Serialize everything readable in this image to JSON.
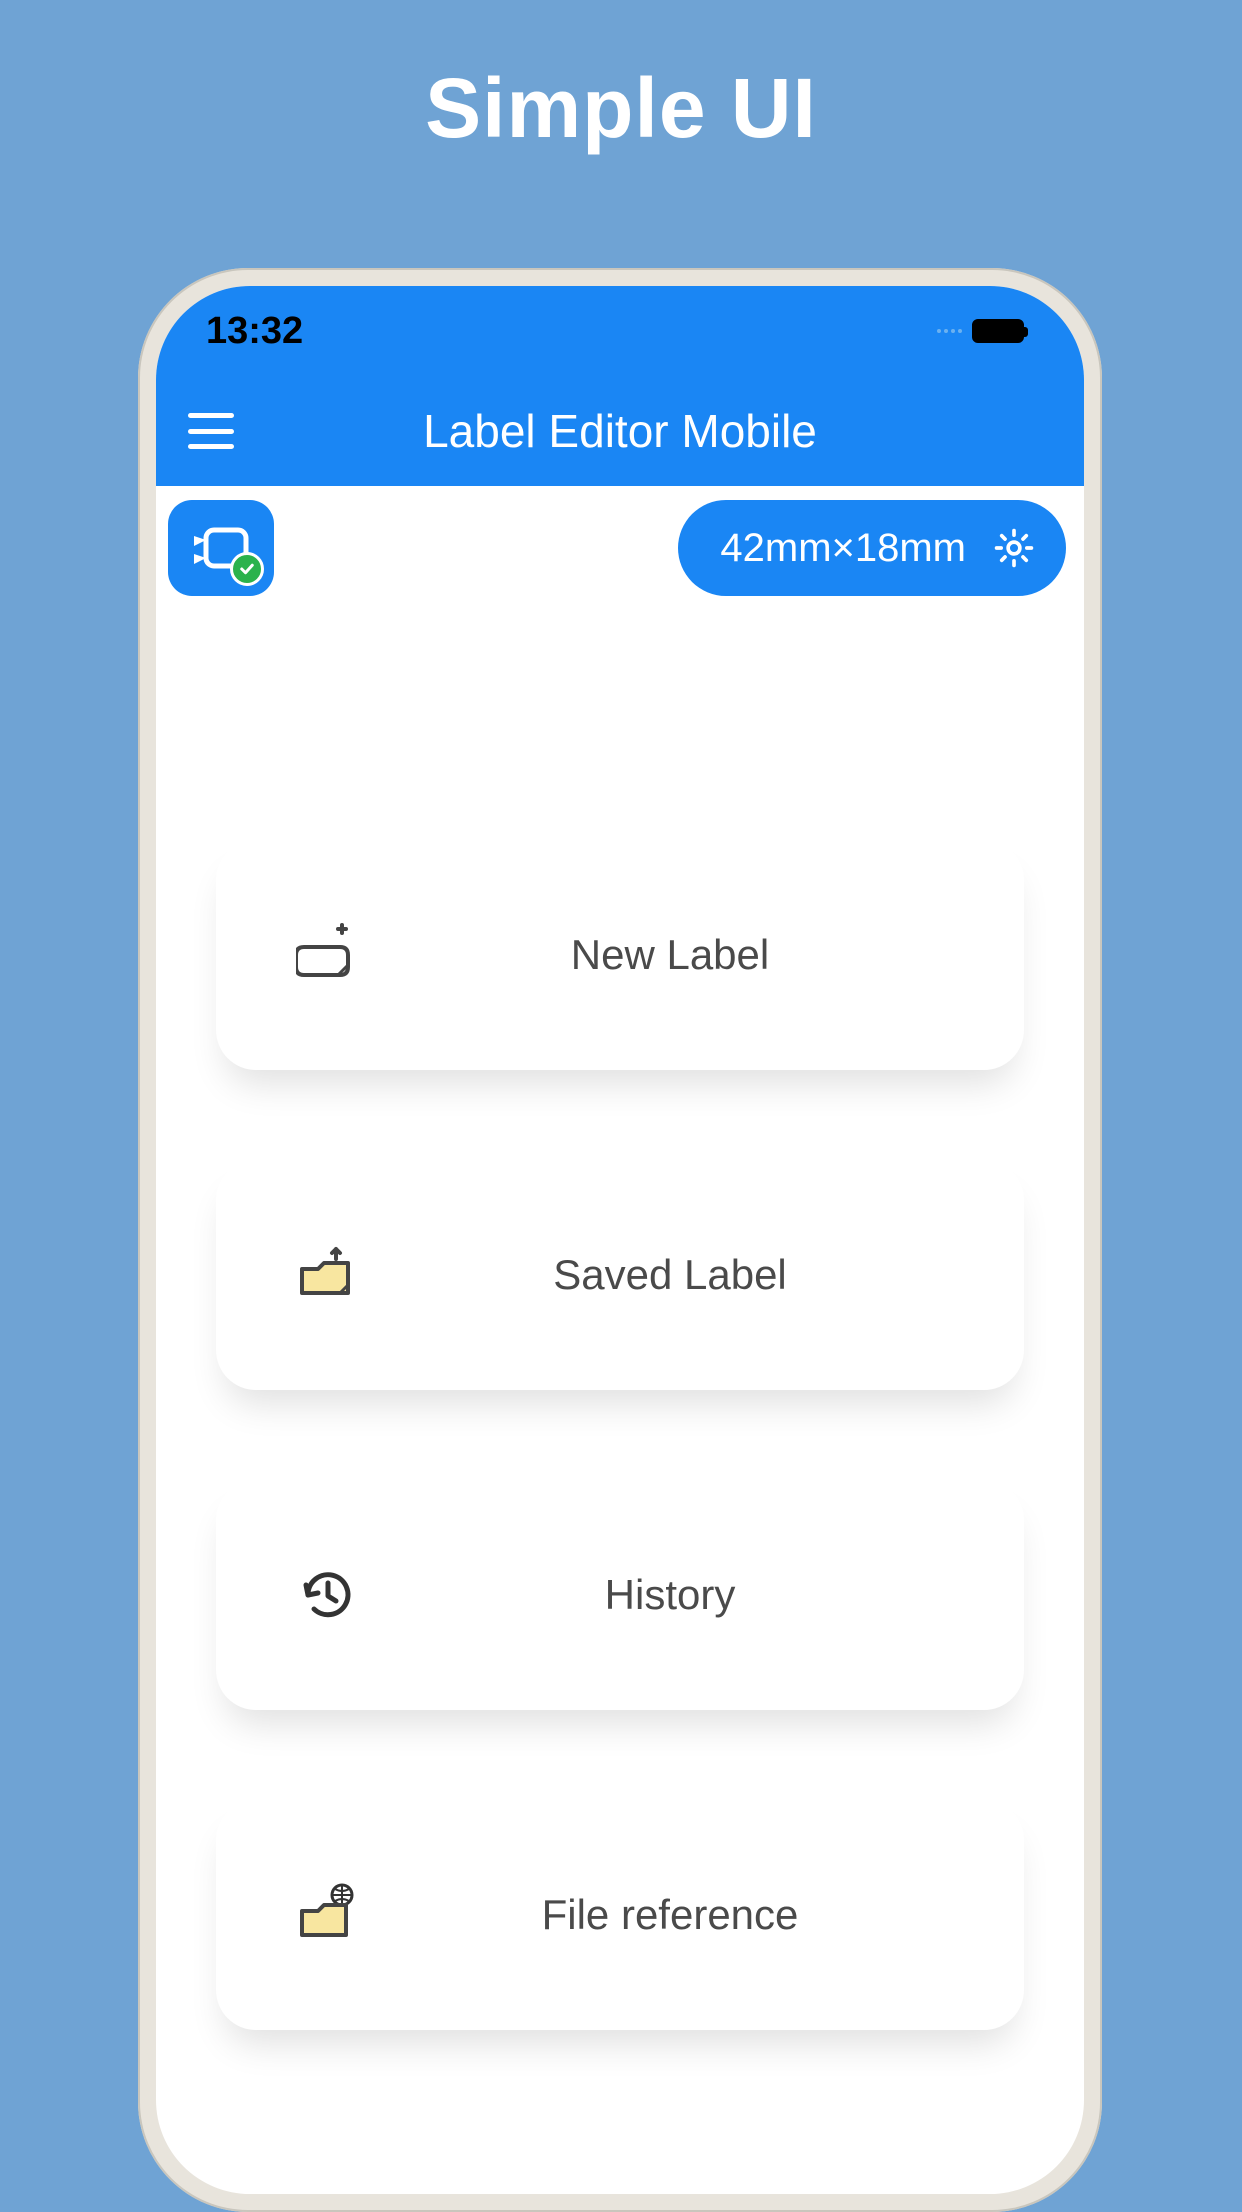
{
  "promo": {
    "title": "Simple UI"
  },
  "status_bar": {
    "time": "13:32"
  },
  "header": {
    "title": "Label Editor Mobile"
  },
  "top_row": {
    "size_label": "42mm×18mm"
  },
  "menu": {
    "new_label": "New Label",
    "saved_label": "Saved Label",
    "history": "History",
    "file_reference": "File reference"
  },
  "colors": {
    "bg": "#6fa3d4",
    "primary": "#1a86f4",
    "text_gray": "#4a4a4a",
    "check_green": "#2bb24c",
    "folder_fill": "#f8e6a0"
  }
}
